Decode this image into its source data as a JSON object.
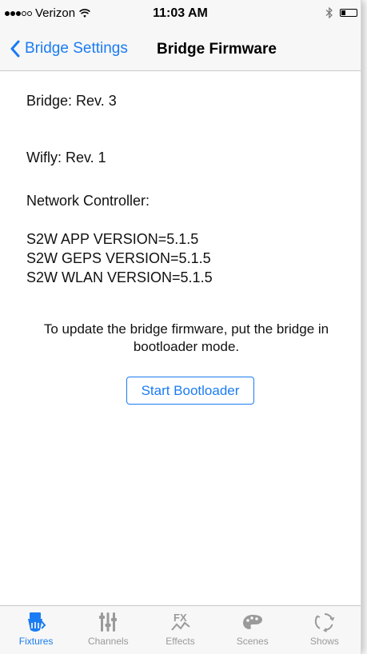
{
  "status_bar": {
    "carrier": "Verizon",
    "time": "11:03 AM",
    "signal_dots_filled": 3,
    "signal_dots_total": 5,
    "battery_level": 0.3
  },
  "nav": {
    "back_label": "Bridge Settings",
    "title": "Bridge Firmware"
  },
  "info": {
    "bridge": "Bridge: Rev. 3",
    "wifly": "Wifly: Rev. 1",
    "network_controller_label": "Network Controller:",
    "versions": [
      "S2W APP VERSION=5.1.5",
      "S2W GEPS VERSION=5.1.5",
      "S2W WLAN VERSION=5.1.5"
    ]
  },
  "update_message": "To update the bridge firmware, put the bridge in bootloader mode.",
  "start_button_label": "Start Bootloader",
  "tabs": [
    {
      "label": "Fixtures",
      "icon": "fixtures-icon",
      "active": true
    },
    {
      "label": "Channels",
      "icon": "channels-icon",
      "active": false
    },
    {
      "label": "Effects",
      "icon": "effects-icon",
      "active": false
    },
    {
      "label": "Scenes",
      "icon": "scenes-icon",
      "active": false
    },
    {
      "label": "Shows",
      "icon": "shows-icon",
      "active": false
    }
  ],
  "colors": {
    "accent": "#1a7cf3",
    "tab_inactive": "#9a9a9a",
    "bar_background": "#f7f7f7"
  }
}
